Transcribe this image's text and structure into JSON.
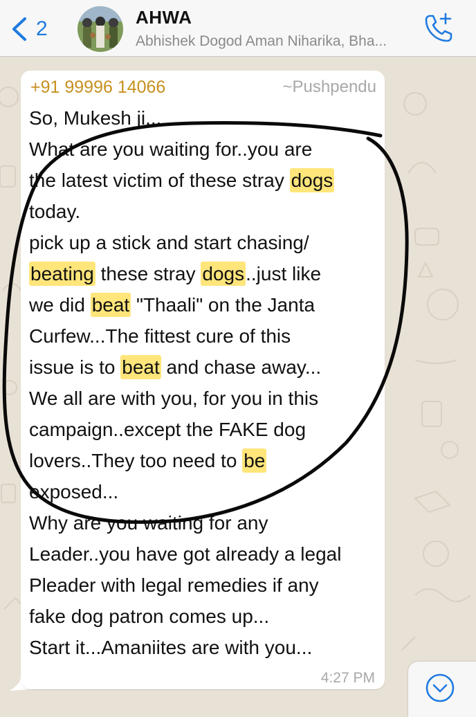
{
  "header": {
    "back_count": "2",
    "title": "AHWA",
    "members": "Abhishek Dogod Aman Niharika, Bha..."
  },
  "message": {
    "sender_phone": "+91 99996 14066",
    "sender_name": "~Pushpendu",
    "lines": [
      [
        {
          "t": "So, Mukesh ji..."
        }
      ],
      [
        {
          "t": "What are you waiting for..you are"
        }
      ],
      [
        {
          "t": "the latest victim of these stray "
        },
        {
          "t": "dogs",
          "hl": true
        }
      ],
      [
        {
          "t": "today."
        }
      ],
      [
        {
          "t": "pick up a stick and start chasing/"
        }
      ],
      [
        {
          "t": "beating",
          "hl": true
        },
        {
          "t": " these stray "
        },
        {
          "t": "dogs",
          "hl": true
        },
        {
          "t": "..just like"
        }
      ],
      [
        {
          "t": "we did "
        },
        {
          "t": "beat",
          "hl": true
        },
        {
          "t": " \"Thaali\" on the Janta"
        }
      ],
      [
        {
          "t": "Curfew...The fittest cure of this"
        }
      ],
      [
        {
          "t": "issue is to "
        },
        {
          "t": "beat",
          "hl": true
        },
        {
          "t": " and chase away..."
        }
      ],
      [
        {
          "t": "We all are with you, for you in this"
        }
      ],
      [
        {
          "t": "campaign..except the FAKE dog"
        }
      ],
      [
        {
          "t": "lovers..They too need to "
        },
        {
          "t": "be",
          "hl": true
        }
      ],
      [
        {
          "t": "exposed..."
        }
      ],
      [
        {
          "t": "Why are you waiting for any"
        }
      ],
      [
        {
          "t": "Leader..you have got already a legal"
        }
      ],
      [
        {
          "t": "Pleader with legal remedies if any"
        }
      ],
      [
        {
          "t": "fake dog patron comes up..."
        }
      ],
      [
        {
          "t": "Start it...Amaniites are with you..."
        }
      ]
    ],
    "timestamp": "4:27 PM"
  },
  "icons": {
    "back": "chevron-left-icon",
    "call": "phone-add-icon",
    "scroll": "chevron-down-circle-icon"
  },
  "colors": {
    "accent": "#1f7ae0",
    "sender": "#c79020",
    "highlight": "#ffe57a"
  }
}
